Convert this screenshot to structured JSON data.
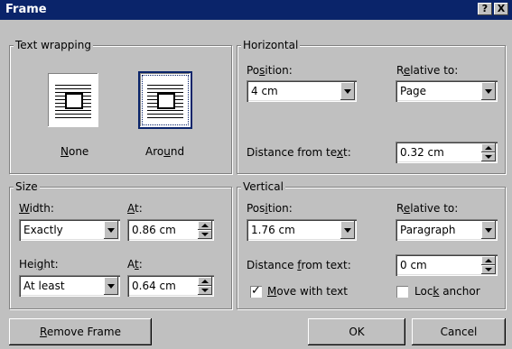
{
  "window": {
    "title": "Frame",
    "help_btn": "?",
    "close_btn": "X"
  },
  "text_wrapping": {
    "legend": "Text wrapping",
    "options": [
      {
        "label": "None",
        "accel": "N",
        "rest": "one",
        "selected": false
      },
      {
        "label": "Around",
        "accel_prefix": "Aro",
        "accel": "u",
        "rest": "nd",
        "selected": true
      }
    ]
  },
  "horizontal": {
    "legend": "Horizontal",
    "position_label_prefix": "Po",
    "position_label_accel": "s",
    "position_label_rest": "ition:",
    "position_value": "4 cm",
    "relative_label_prefix": "R",
    "relative_label_accel": "e",
    "relative_label_rest": "lative to:",
    "relative_value": "Page",
    "distance_label_prefix": "Distance from te",
    "distance_label_accel": "x",
    "distance_label_rest": "t:",
    "distance_value": "0.32 cm"
  },
  "size": {
    "legend": "Size",
    "width_label_accel": "W",
    "width_label_rest": "idth:",
    "width_value": "Exactly",
    "width_at_label_accel": "A",
    "width_at_label_rest": "t:",
    "width_at_value": "0.86 cm",
    "height_label_prefix": "Hei",
    "height_label_accel": "g",
    "height_label_rest": "ht:",
    "height_value": "At least",
    "height_at_label_prefix": "A",
    "height_at_label_accel": "t",
    "height_at_label_rest": ":",
    "height_at_value": "0.64 cm"
  },
  "vertical": {
    "legend": "Vertical",
    "position_label_prefix": "Pos",
    "position_label_accel": "i",
    "position_label_rest": "tion:",
    "position_value": "1.76 cm",
    "relative_label_prefix": "R",
    "relative_label_accel": "e",
    "relative_label_rest": "lative to:",
    "relative_value": "Paragraph",
    "distance_label_prefix": "Distance ",
    "distance_label_accel": "f",
    "distance_label_rest": "rom text:",
    "distance_value": "0 cm",
    "move_with_text": {
      "accel": "M",
      "rest": "ove with text",
      "checked": true
    },
    "lock_anchor": {
      "prefix": "Loc",
      "accel": "k",
      "rest": " anchor",
      "checked": false
    }
  },
  "buttons": {
    "remove_accel": "R",
    "remove_rest": "emove Frame",
    "ok": "OK",
    "cancel": "Cancel"
  }
}
